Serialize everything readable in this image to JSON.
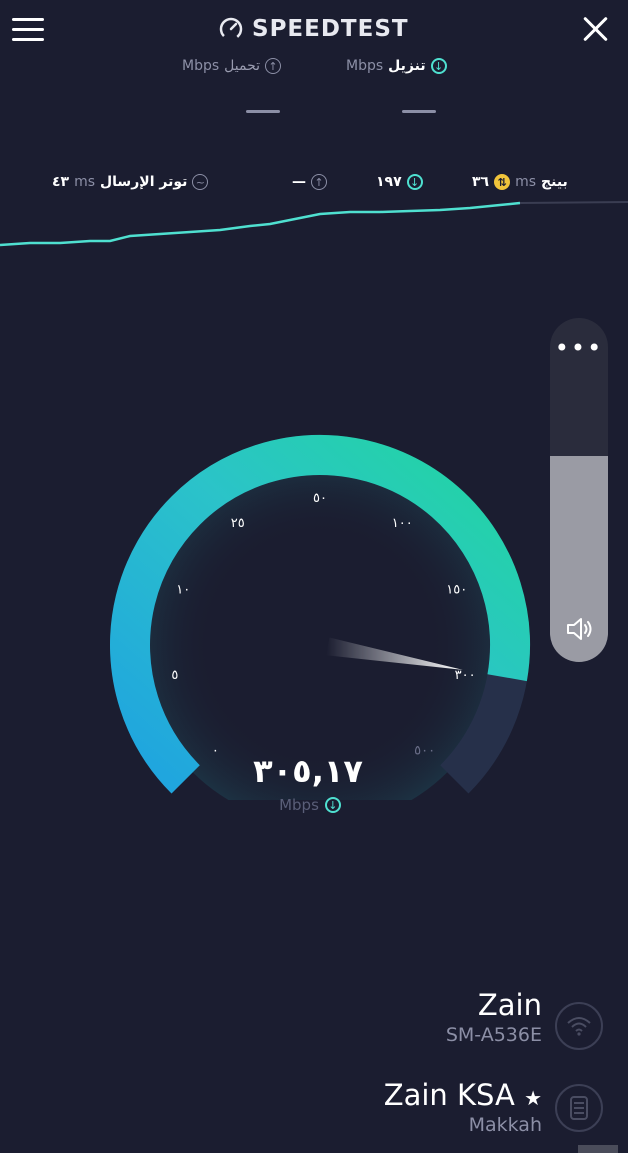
{
  "header": {
    "title": "SPEEDTEST",
    "download": {
      "label": "تنزيل",
      "unit": "Mbps",
      "value": "—"
    },
    "upload": {
      "label": "تحميل",
      "unit": "Mbps",
      "value": "—"
    }
  },
  "stats": {
    "ping": {
      "label": "بينج",
      "unit": "ms",
      "value": "٣٦"
    },
    "download_ms": {
      "value": "١٩٧"
    },
    "upload_ms": {
      "value": "—"
    },
    "jitter": {
      "label": "توتر الإرسال",
      "unit": "ms",
      "value": "٤٣"
    }
  },
  "gauge": {
    "ticks": [
      "٠",
      "٥",
      "١٠",
      "٢٥",
      "٥٠",
      "١٠٠",
      "١٥٠",
      "٣٠٠",
      "٥٠٠"
    ],
    "speed": "٣٠٥,١٧",
    "unit": "Mbps",
    "progress_percent": 87
  },
  "volume": {
    "level_percent": 60
  },
  "isp": {
    "name": "Zain",
    "device": "SM-A536E"
  },
  "server": {
    "name": "Zain KSA",
    "star": "★",
    "location": "Makkah"
  },
  "colors": {
    "background": "#1b1d30",
    "accent_teal": "#4fe0d0",
    "gauge_blue": "#1fa3e0",
    "gauge_green": "#22d6a0"
  }
}
